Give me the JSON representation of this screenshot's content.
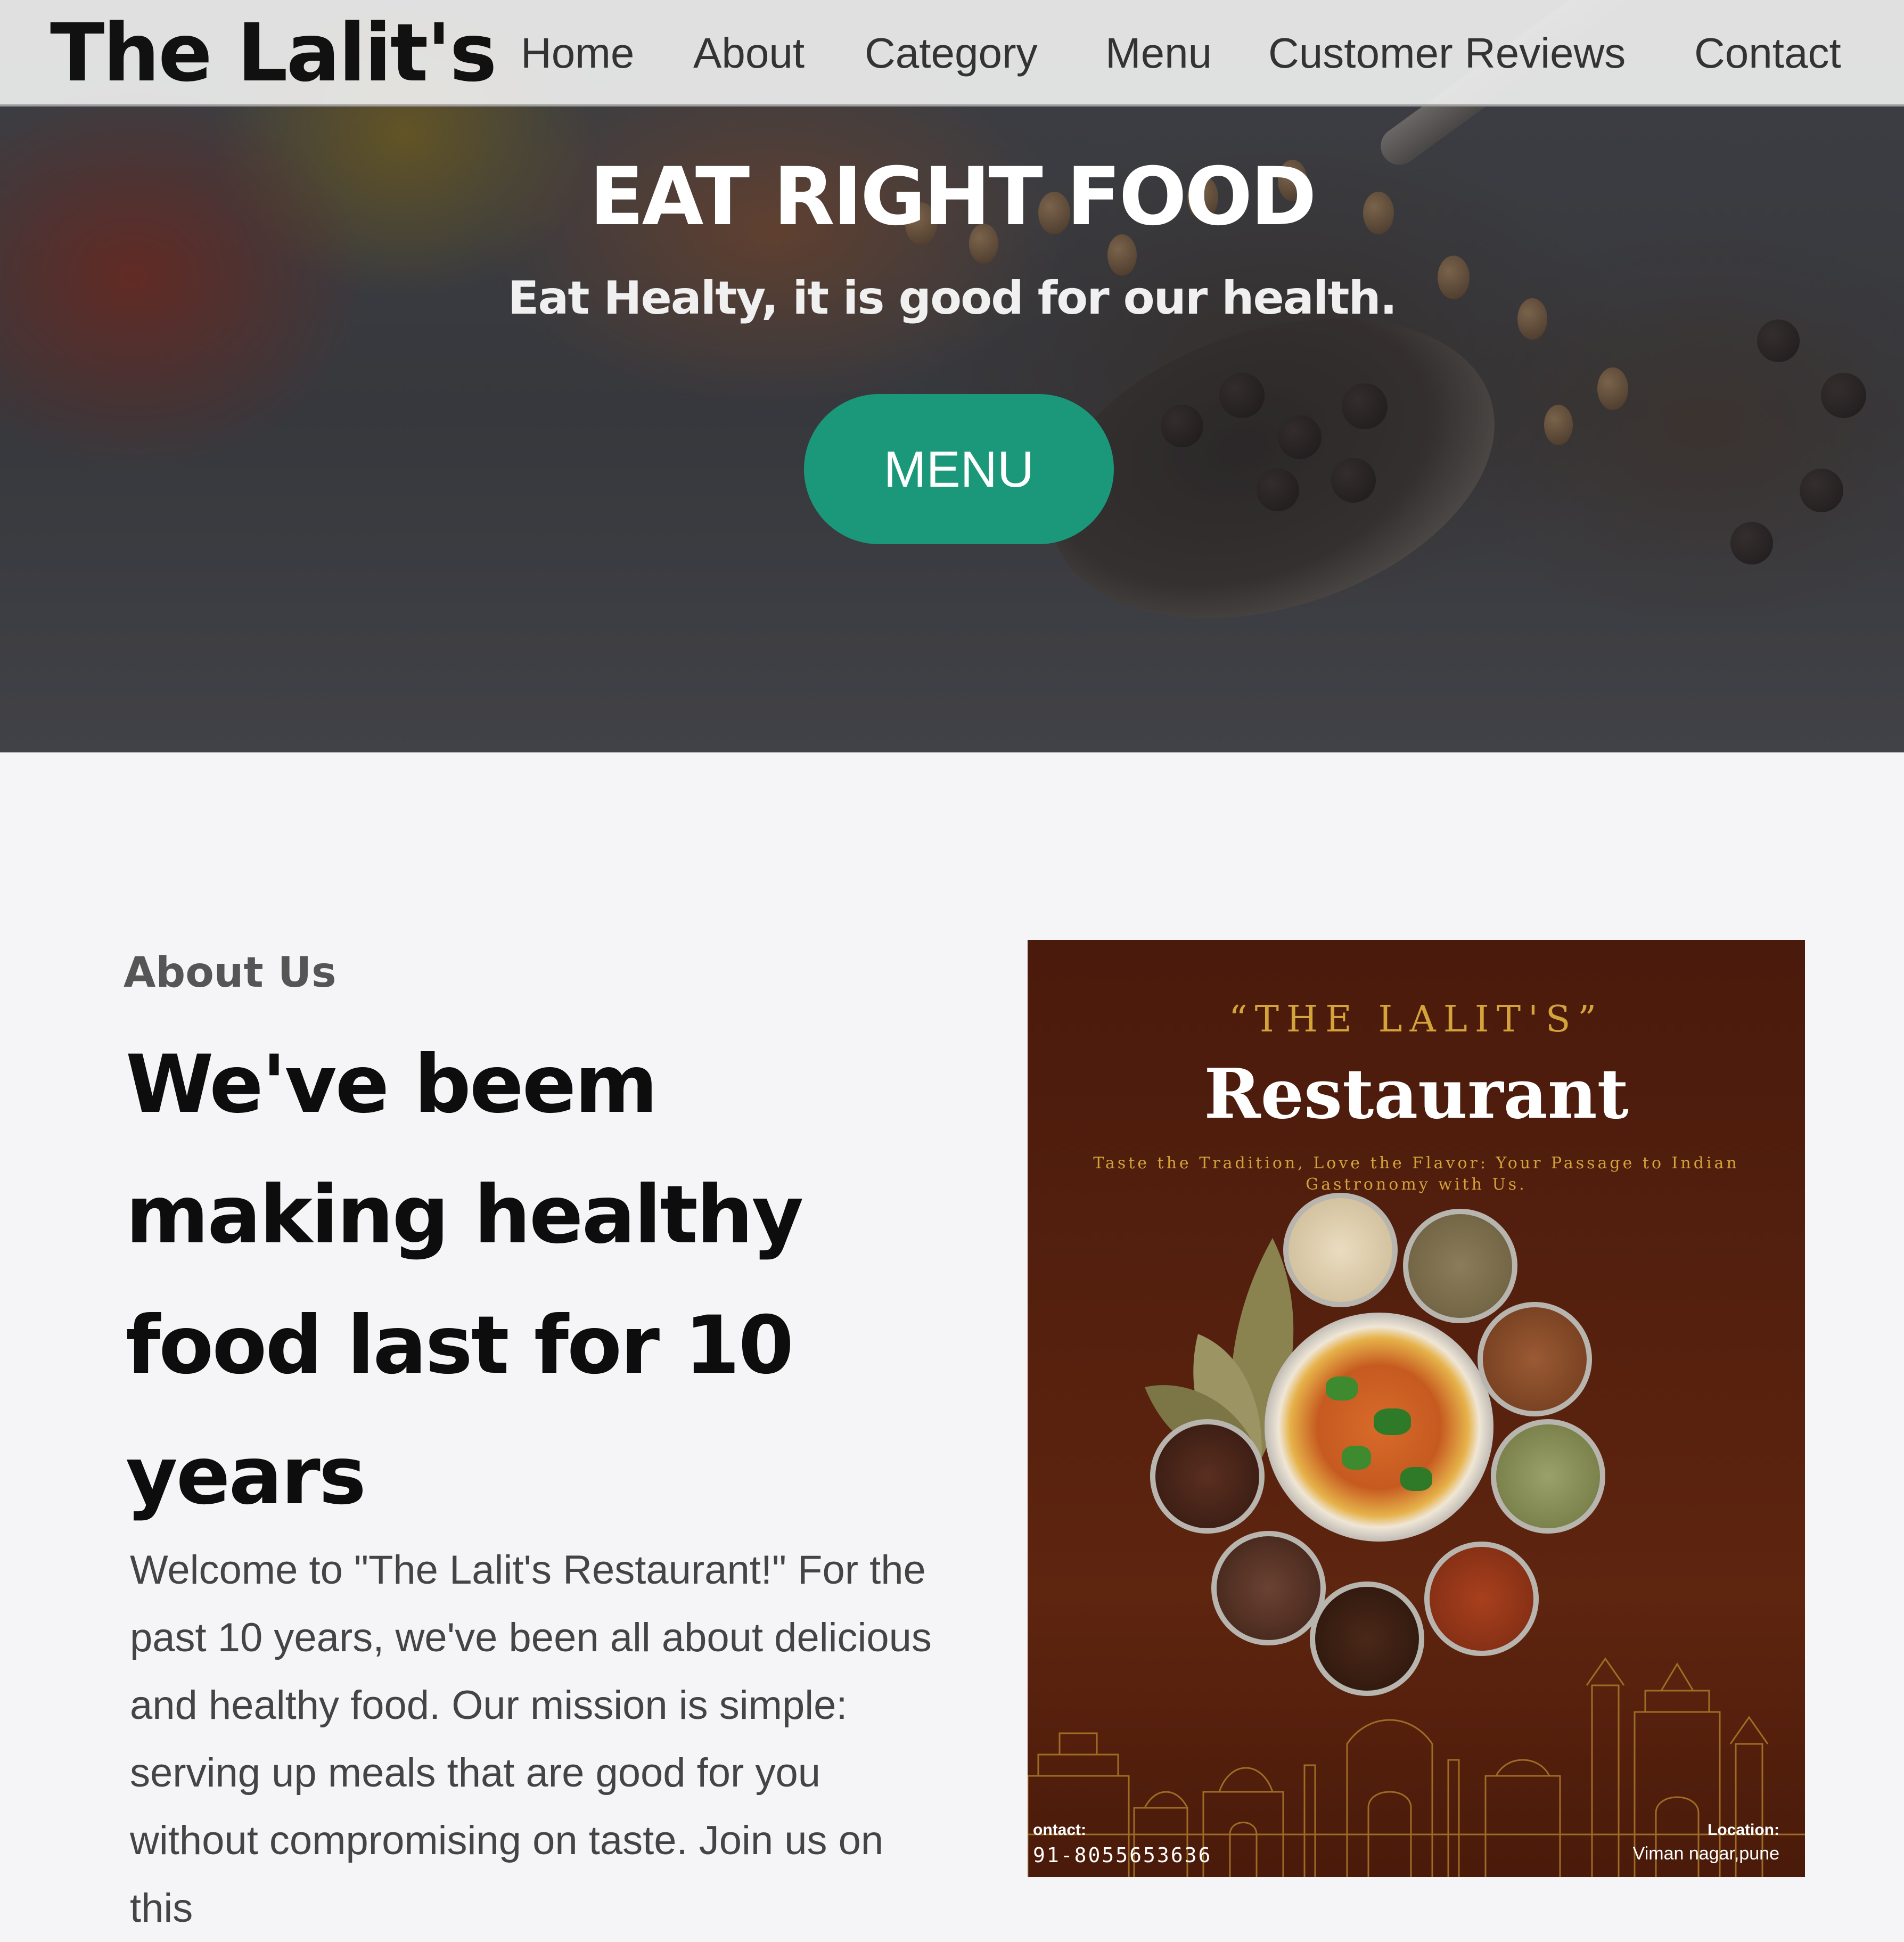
{
  "nav": {
    "brand": "The Lalit's",
    "links": [
      "Home",
      "About",
      "Category",
      "Menu",
      "Customer Reviews",
      "Contact"
    ]
  },
  "hero": {
    "title": "EAT RIGHT FOOD",
    "subtitle": "Eat Healty, it is good for our health.",
    "button_label": "MENU"
  },
  "about": {
    "label": "About Us",
    "heading": "We've beem making healthy food last for 10 years",
    "paragraph": "Welcome to \"The Lalit's Restaurant!\" For the past 10 years, we've been all about delicious and healthy food. Our mission is simple: serving up meals that are good for you without compromising on taste. Join us on this"
  },
  "poster": {
    "arc_text": "“THE LALIT'S”",
    "title": "Restaurant",
    "tagline": "Taste the Tradition, Love the Flavor: Your Passage to Indian Gastronomy with Us.",
    "contact_label": "ontact:",
    "contact_value": "91-8055653636",
    "location_label": "Location:",
    "location_value": "Viman nagar,pune"
  },
  "colors": {
    "accent": "#1a9879",
    "nav_bg": "#eeeeee",
    "page_bg": "#f5f4f7",
    "poster_bg": "#55200e",
    "poster_gold": "#d4a33a"
  }
}
